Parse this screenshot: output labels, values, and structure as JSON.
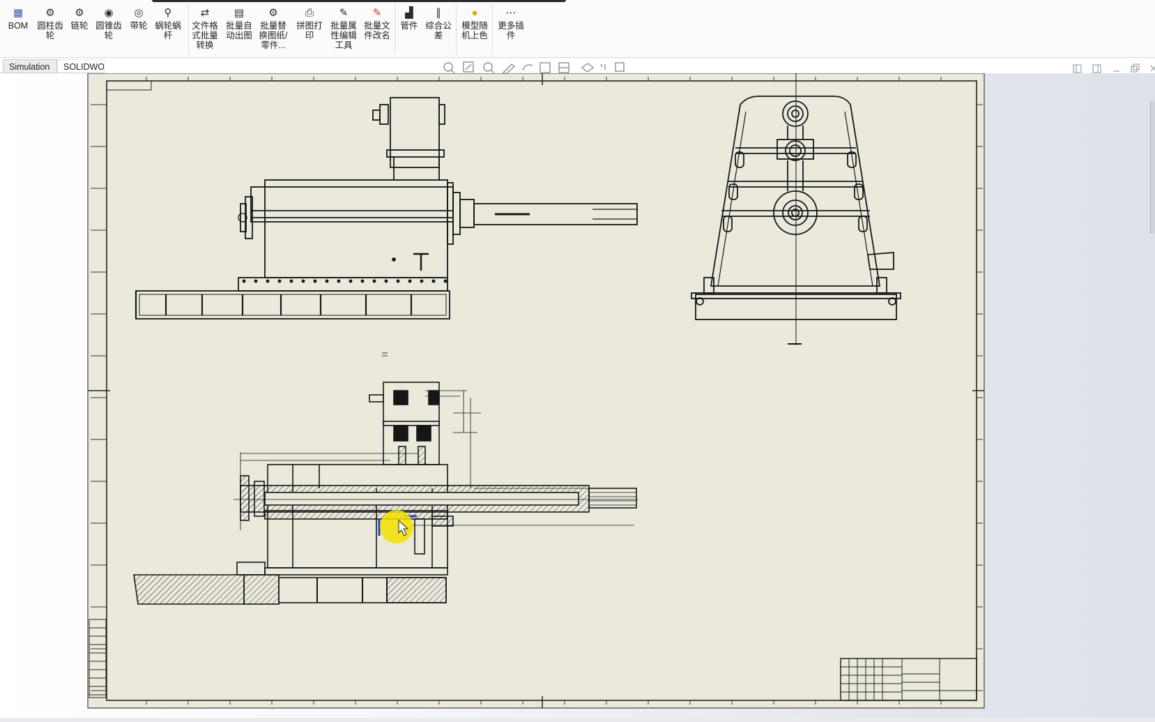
{
  "ribbon": {
    "buttons": [
      {
        "id": "bom",
        "label": "BOM",
        "icon": "bom-table-icon"
      },
      {
        "id": "cylindrical-gear",
        "label": "圆柱齿\n轮",
        "icon": "cylindrical-gear-icon"
      },
      {
        "id": "sprocket",
        "label": "链轮",
        "icon": "sprocket-icon"
      },
      {
        "id": "bevel-gear",
        "label": "圆锥齿\n轮",
        "icon": "bevel-gear-icon"
      },
      {
        "id": "pulley",
        "label": "带轮",
        "icon": "pulley-icon"
      },
      {
        "id": "worm-gear",
        "label": "蜗轮蜗\n杆",
        "icon": "worm-gear-icon"
      },
      {
        "id": "file-convert",
        "label": "文件格\n式批量\n转换",
        "icon": "file-convert-icon"
      },
      {
        "id": "batch-drawing",
        "label": "批量自\n动出图",
        "icon": "batch-drawing-icon"
      },
      {
        "id": "batch-replace",
        "label": "批量替\n换图纸/\n零件...",
        "icon": "batch-replace-icon"
      },
      {
        "id": "combine-print",
        "label": "拼图打\n印",
        "icon": "printer-icon"
      },
      {
        "id": "batch-props",
        "label": "批量属\n性编辑\n工具",
        "icon": "property-edit-icon"
      },
      {
        "id": "batch-rename",
        "label": "批量文\n件改名",
        "icon": "rename-icon"
      },
      {
        "id": "pipe",
        "label": "管件",
        "icon": "pipe-fitting-icon"
      },
      {
        "id": "tolerance",
        "label": "综合公\n差",
        "icon": "tolerance-icon"
      },
      {
        "id": "random-color",
        "label": "模型随\n机上色",
        "icon": "color-ball-icon"
      },
      {
        "id": "more-plugins",
        "label": "更多插\n件",
        "icon": "more-icon"
      }
    ]
  },
  "tabs": [
    {
      "label": "Simulation"
    },
    {
      "label": "SOLIDWOR"
    }
  ],
  "heads_up_icons": [
    "zoom-to-fit-icon",
    "zoom-area-icon",
    "previous-view-icon",
    "sketch-icon",
    "redo-icon",
    "section-view-icon",
    "display-style-icon",
    "hide-show-icon",
    "appearance-icon",
    "scene-icon"
  ],
  "window_controls": [
    "tile-left-icon",
    "tile-right-icon",
    "minimize-icon",
    "restore-icon",
    "close-icon"
  ],
  "colors": {
    "sheet_paper": "#ebe9dc",
    "line": "#1a1a1a",
    "highlight": "#f5e100",
    "selection": "#1c3fd0"
  }
}
